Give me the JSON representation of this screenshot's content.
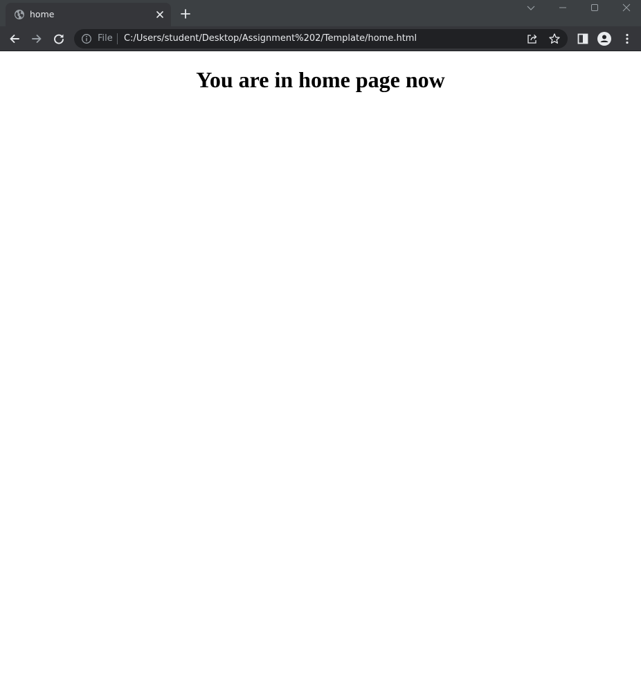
{
  "tab": {
    "title": "home",
    "favicon": "globe-icon"
  },
  "toolbar": {
    "scheme_label": "File",
    "url": "C:/Users/student/Desktop/Assignment%202/Template/home.html"
  },
  "page": {
    "heading": "You are in home page now"
  },
  "colors": {
    "tabstrip_bg": "#3c4043",
    "toolbar_bg": "#35363a",
    "omnibox_bg": "#202124",
    "page_bg": "#ffffff"
  }
}
